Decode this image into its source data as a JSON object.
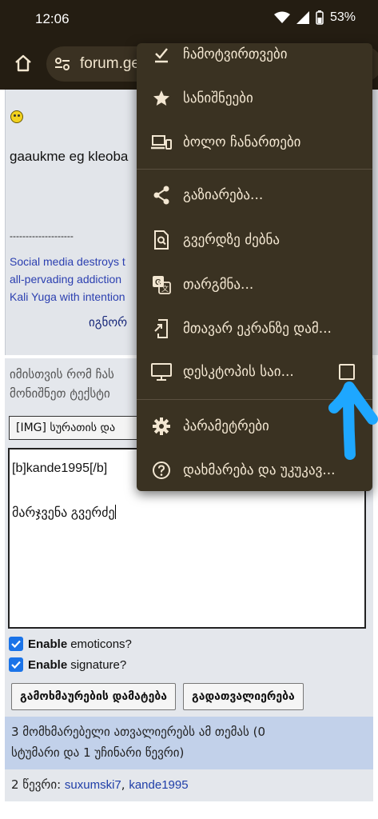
{
  "status": {
    "time": "12:06",
    "battery": "53%"
  },
  "toolbar": {
    "url": "forum.ge/"
  },
  "post": {
    "text": "gaaukme eg kleoba",
    "sig_divider": "--------------------",
    "sig_lines": [
      "Social media destroys t",
      "all-pervading addiction",
      "Kali Yuga with intention"
    ],
    "ignore": "იგნორ"
  },
  "reply": {
    "note_lines": [
      "იმისთვის რომ ჩას",
      "მონიშნეთ ტექსტი"
    ],
    "img_select": "[IMG] სურათის და",
    "message_line1": "[b]kande1995[/b]",
    "message_line2": "მარჯვენა გვერძე",
    "enable_emoticons_bold": "Enable",
    "enable_emoticons_rest": "emoticons?",
    "enable_signature_bold": "Enable",
    "enable_signature_rest": "signature?",
    "add_reply_button": "გამოხმაურების დამატება",
    "preview_button": "გადათვალიერება"
  },
  "users": {
    "reading_line1": "3 მომხმარებელი ათვალიერებს ამ თემას (0",
    "reading_line2": "სტუმარი და 1 უჩინარი წევრი)",
    "readers_prefix": "2 წევრი: ",
    "reader1": "suxumski7",
    "reader_sep": ", ",
    "reader2": "kande1995"
  },
  "menu": {
    "items": [
      {
        "label": "ჩამოტვირთვები",
        "icon": "downloads-icon"
      },
      {
        "label": "სანიშნეები",
        "icon": "star-icon"
      },
      {
        "label": "ბოლო ჩანართები",
        "icon": "devices-icon"
      },
      {
        "label": "გაზიარება...",
        "icon": "share-icon"
      },
      {
        "label": "გვერდზე ძებნა",
        "icon": "find-in-page-icon"
      },
      {
        "label": "თარგმნა...",
        "icon": "translate-icon"
      },
      {
        "label": "მთავარ ეკრანზე დამ...",
        "icon": "add-to-home-icon"
      },
      {
        "label": "დესკტოპის საი...",
        "icon": "desktop-icon"
      },
      {
        "label": "პარამეტრები",
        "icon": "settings-icon"
      },
      {
        "label": "დახმარება და უკუკავ...",
        "icon": "help-icon"
      }
    ],
    "desktop_site_checked": false
  },
  "colors": {
    "accent": "#1a73e8",
    "menu_bg": "#3a3222",
    "chrome_bg": "#241d12",
    "scribble": "#1ea7ff"
  }
}
